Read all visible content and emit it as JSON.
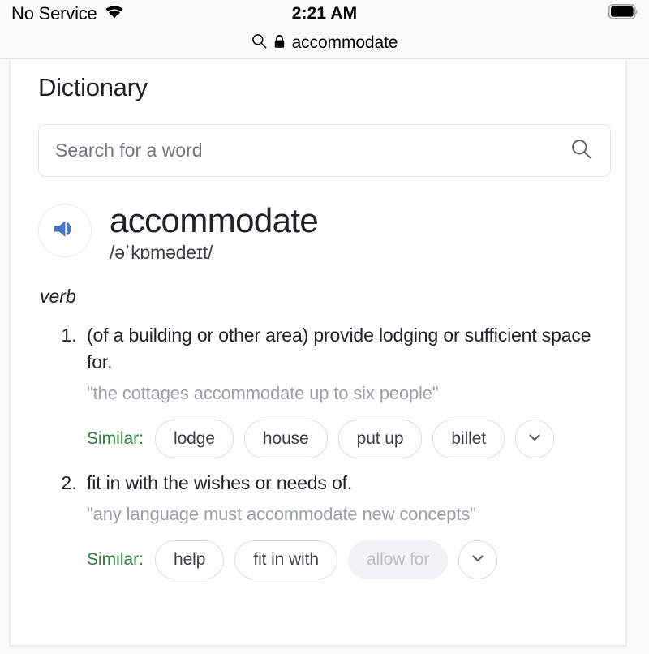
{
  "status_bar": {
    "carrier": "No Service",
    "wifi_icon": "wifi-icon",
    "time": "2:21 AM",
    "battery_icon": "battery-full-icon"
  },
  "url_bar": {
    "search_icon": "search-icon",
    "lock_icon": "lock-icon",
    "url_text": "accommodate"
  },
  "page": {
    "title": "Dictionary"
  },
  "search": {
    "placeholder": "Search for a word",
    "value": "",
    "icon": "search-icon"
  },
  "entry": {
    "audio_icon": "speaker-icon",
    "headword": "accommodate",
    "phonetic": "/əˈkɒmədeɪt/",
    "part_of_speech": "verb",
    "definitions": [
      {
        "number": "1.",
        "text": "(of a building or other area) provide lodging or sufficient space for.",
        "example": "\"the cottages accommodate up to six people\"",
        "similar_label": "Similar:",
        "similar": [
          {
            "label": "lodge",
            "state": "normal"
          },
          {
            "label": "house",
            "state": "normal"
          },
          {
            "label": "put up",
            "state": "normal"
          },
          {
            "label": "billet",
            "state": "normal"
          }
        ],
        "more_icon": "chevron-down-icon"
      },
      {
        "number": "2.",
        "text": "fit in with the wishes or needs of.",
        "example": "\"any language must accommodate new concepts\"",
        "similar_label": "Similar:",
        "similar": [
          {
            "label": "help",
            "state": "normal"
          },
          {
            "label": "fit in with",
            "state": "normal"
          },
          {
            "label": "allow for",
            "state": "muted"
          }
        ],
        "more_icon": "chevron-down-icon"
      }
    ]
  },
  "colors": {
    "accent_blue": "#4674c6",
    "similar_green": "#2e7d3a",
    "text_primary": "#202124",
    "text_muted": "#9aa0a6",
    "chip_border": "#dadce0",
    "chip_muted_bg": "#f1f3f4"
  }
}
